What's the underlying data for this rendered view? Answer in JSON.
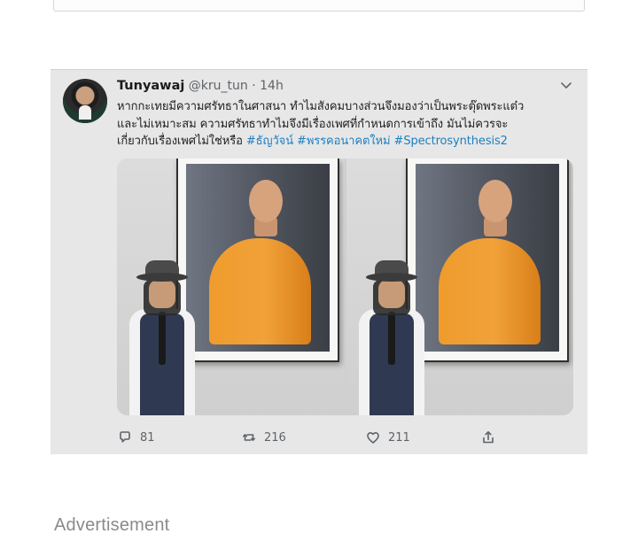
{
  "tweet": {
    "display_name": "Tunyawaj",
    "handle": "@kru_tun",
    "separator": "·",
    "time": "14h",
    "text_line1": "หากกะเทยมีความศรัทธาในศาสนา ทำไมสังคมบางส่วนจึงมองว่าเป็นพระตุ๊ดพระแต๋ว",
    "text_line2": "และไม่เหมาะสม ความศรัทธาทำไมจึงมีเรื่องเพศที่กำหนดการเข้าถึง มันไม่ควรจะ",
    "text_line3_prefix": "เกี่ยวกับเรื่องเพศไม่ใช่หรือ ",
    "hashtags": [
      "#ธัญวัจน์",
      "#พรรคอนาคตใหม่",
      "#Spectrosynthesis2"
    ],
    "actions": {
      "reply_count": "81",
      "retweet_count": "216",
      "like_count": "211"
    }
  },
  "advertisement_label": "Advertisement",
  "icons": {
    "chevron": "chevron-down-icon",
    "reply": "reply-icon",
    "retweet": "retweet-icon",
    "like": "heart-icon",
    "share": "share-icon"
  },
  "colors": {
    "card_bg": "#e7e7e7",
    "hashtag": "#1d7fc0",
    "muted": "#5f6368",
    "ad_label": "#8a8a8a"
  }
}
